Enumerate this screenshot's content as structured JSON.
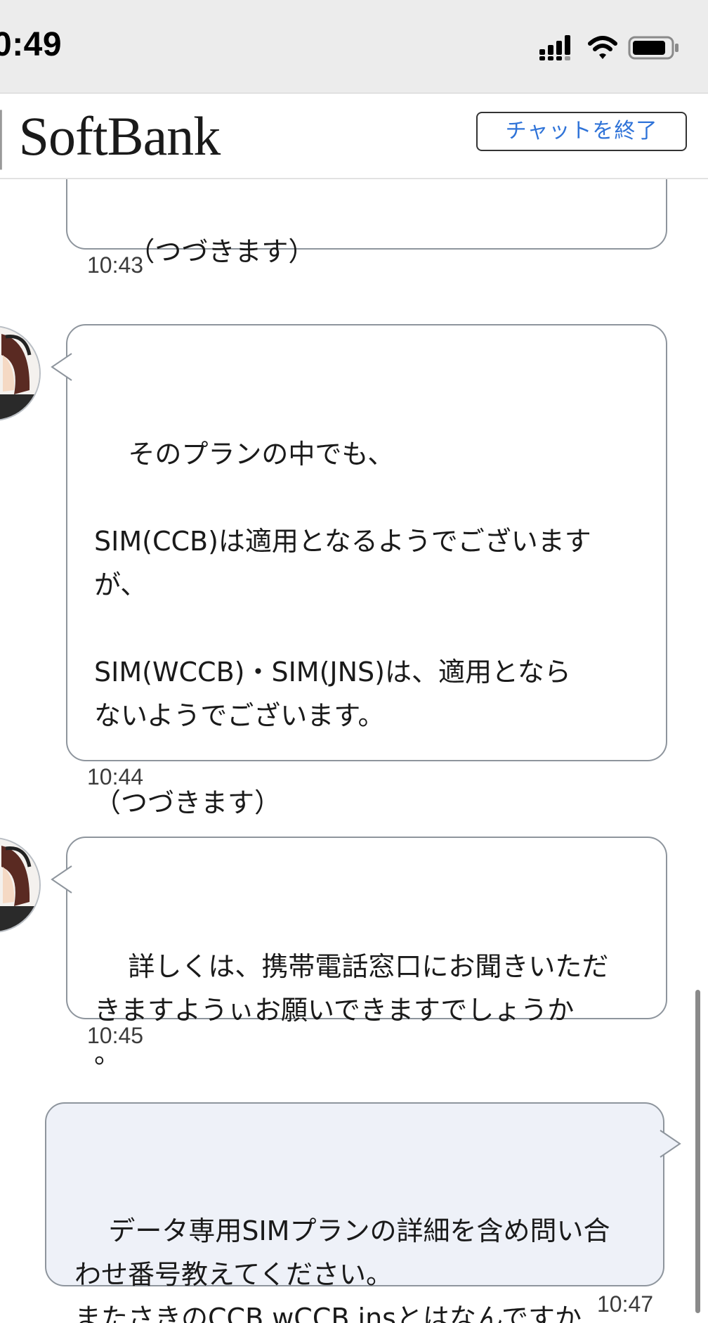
{
  "status_bar": {
    "time": "0:49"
  },
  "header": {
    "brand": "SoftBank",
    "end_chat_label": "チャットを終了"
  },
  "colors": {
    "accent": "#2f73d8",
    "user_bubble": "#eef1f8",
    "border": "#8e959d"
  },
  "messages": [
    {
      "sender": "agent",
      "text": "（つづきます）",
      "time": "10:43"
    },
    {
      "sender": "agent",
      "text": "そのプランの中でも、\n\nSIM(CCB)は適用となるようでございます\nが、\n\nSIM(WCCB)・SIM(JNS)は、適用となら\nないようでございます。\n\n（つづきます）",
      "time": "10:44"
    },
    {
      "sender": "agent",
      "text": "詳しくは、携帯電話窓口にお聞きいただ\nきますようぃお願いできますでしょうか\n。",
      "time": "10:45"
    },
    {
      "sender": "user",
      "text": "データ専用SIMプランの詳細を含め問い合\nわせ番号教えてください。\nまたさきのCCB wCCB jnsとはなんですか",
      "time": "10:47"
    }
  ],
  "icons": [
    "signal-icon",
    "wifi-icon",
    "battery-icon",
    "agent-avatar"
  ]
}
